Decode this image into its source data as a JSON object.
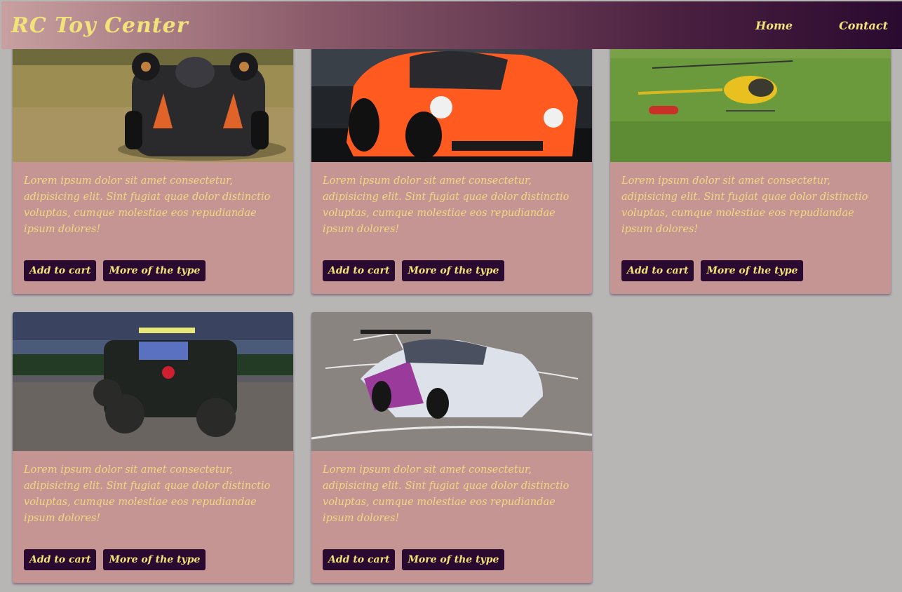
{
  "header": {
    "brand": "RC Toy Center",
    "nav": [
      "Home",
      "Contact"
    ]
  },
  "cards": [
    {
      "image": "rc buggy on grass",
      "text": "Lorem ipsum dolor sit amet consectetur, adipisicing elit. Sint fugiat quae dolor distinctio voluptas, cumque molestiae eos repudiandae ipsum dolores!",
      "add_label": "Add to cart",
      "more_label": "More of the type"
    },
    {
      "image": "orange rc sports car",
      "text": "Lorem ipsum dolor sit amet consectetur, adipisicing elit. Sint fugiat quae dolor distinctio voluptas, cumque molestiae eos repudiandae ipsum dolores!",
      "add_label": "Add to cart",
      "more_label": "More of the type"
    },
    {
      "image": "rc helicopter on field",
      "text": "Lorem ipsum dolor sit amet consectetur, adipisicing elit. Sint fugiat quae dolor distinctio voluptas, cumque molestiae eos repudiandae ipsum dolores!",
      "add_label": "Add to cart",
      "more_label": "More of the type"
    },
    {
      "image": "rc rock crawler at dusk",
      "text": "Lorem ipsum dolor sit amet consectetur, adipisicing elit. Sint fugiat quae dolor distinctio voluptas, cumque molestiae eos repudiandae ipsum dolores!",
      "add_label": "Add to cart",
      "more_label": "More of the type"
    },
    {
      "image": "rc drift car on asphalt",
      "text": "Lorem ipsum dolor sit amet consectetur, adipisicing elit. Sint fugiat quae dolor distinctio voluptas, cumque molestiae eos repudiandae ipsum dolores!",
      "add_label": "Add to cart",
      "more_label": "More of the type"
    }
  ],
  "colors": {
    "background": "#b7b6b5",
    "card": "#c49592",
    "accent_text": "#f2e27a",
    "button": "#2a0a30"
  }
}
